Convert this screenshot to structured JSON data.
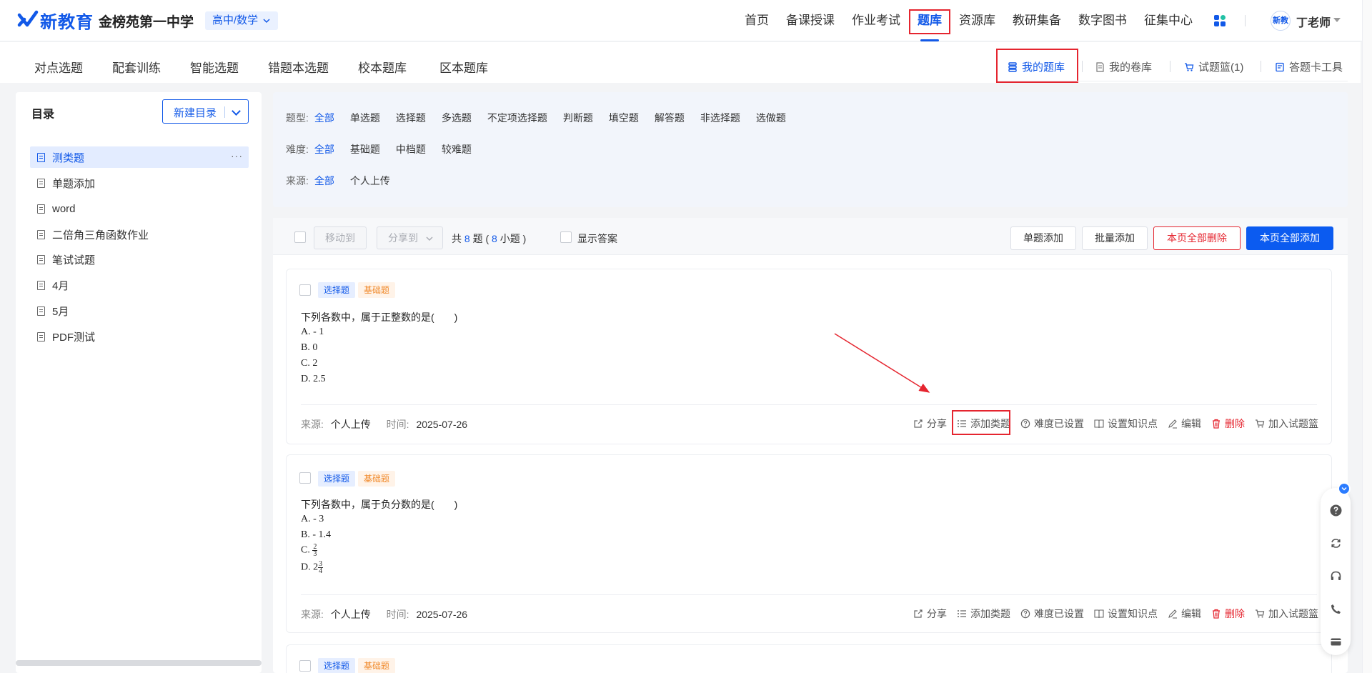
{
  "header": {
    "logo_text": "新教育",
    "school_name": "金榜苑第一中学",
    "subject_selector": "高中/数学",
    "nav": [
      "首页",
      "备课授课",
      "作业考试",
      "题库",
      "资源库",
      "教研集备",
      "数字图书",
      "征集中心"
    ],
    "active_nav": "题库",
    "avatar_text": "新教",
    "username": "丁老师"
  },
  "subnav": {
    "left": [
      "对点选题",
      "配套训练",
      "智能选题",
      "错题本选题",
      "校本题库",
      "区本题库"
    ],
    "right": {
      "my_bank": "我的题库",
      "my_papers": "我的卷库",
      "basket": "试题篮(1)",
      "answer_card": "答题卡工具"
    }
  },
  "catalog": {
    "title": "目录",
    "new_button": "新建目录",
    "items": [
      "测类题",
      "单题添加",
      "word",
      "二倍角三角函数作业",
      "笔试试题",
      "4月",
      "5月",
      "PDF测试"
    ],
    "active_index": 0,
    "more": "···"
  },
  "filters": {
    "type": {
      "label": "题型:",
      "options": [
        "全部",
        "单选题",
        "选择题",
        "多选题",
        "不定项选择题",
        "判断题",
        "填空题",
        "解答题",
        "非选择题",
        "选做题"
      ],
      "selected": 0
    },
    "difficulty": {
      "label": "难度:",
      "options": [
        "全部",
        "基础题",
        "中档题",
        "较难题"
      ],
      "selected": 0
    },
    "source": {
      "label": "来源:",
      "options": [
        "全部",
        "个人上传"
      ],
      "selected": 0
    }
  },
  "toolbar": {
    "move_to": "移动到",
    "share_to": "分享到",
    "count_prefix": "共",
    "count_total": "8",
    "count_mid": "题 (",
    "count_sub": "8",
    "count_suffix": "小题 )",
    "show_answer": "显示答案",
    "single_add": "单题添加",
    "batch_add": "批量添加",
    "delete_page": "本页全部删除",
    "add_page": "本页全部添加"
  },
  "questions": [
    {
      "type_tag": "选择题",
      "level_tag": "基础题",
      "stem": "下列各数中，属于正整数的是(　　)",
      "options": [
        "A.  - 1",
        "B. 0",
        "C. 2",
        "D. 2.5"
      ],
      "source_label": "来源:",
      "source": "个人上传",
      "time_label": "时间:",
      "time": "2025-07-26"
    },
    {
      "type_tag": "选择题",
      "level_tag": "基础题",
      "stem": "下列各数中，属于负分数的是(　　)",
      "options": [
        "A.  - 3",
        "B.  - 1.4",
        "C. ",
        "D. 2"
      ],
      "option_c_frac": {
        "num": "2",
        "den": "3"
      },
      "option_d_frac": {
        "num": "3",
        "den": "4"
      },
      "source_label": "来源:",
      "source": "个人上传",
      "time_label": "时间:",
      "time": "2025-07-26"
    },
    {
      "type_tag": "选择题",
      "level_tag": "基础题"
    }
  ],
  "actions": {
    "share": "分享",
    "add_category": "添加类题",
    "difficulty_set": "难度已设置",
    "set_knowledge": "设置知识点",
    "edit": "编辑",
    "delete": "删除",
    "add_basket": "加入试题篮"
  },
  "colors": {
    "brand": "#1259e8",
    "highlight": "#e5252f",
    "primary_button": "#0b5bf0",
    "tag_orange": "#f08a2c"
  }
}
